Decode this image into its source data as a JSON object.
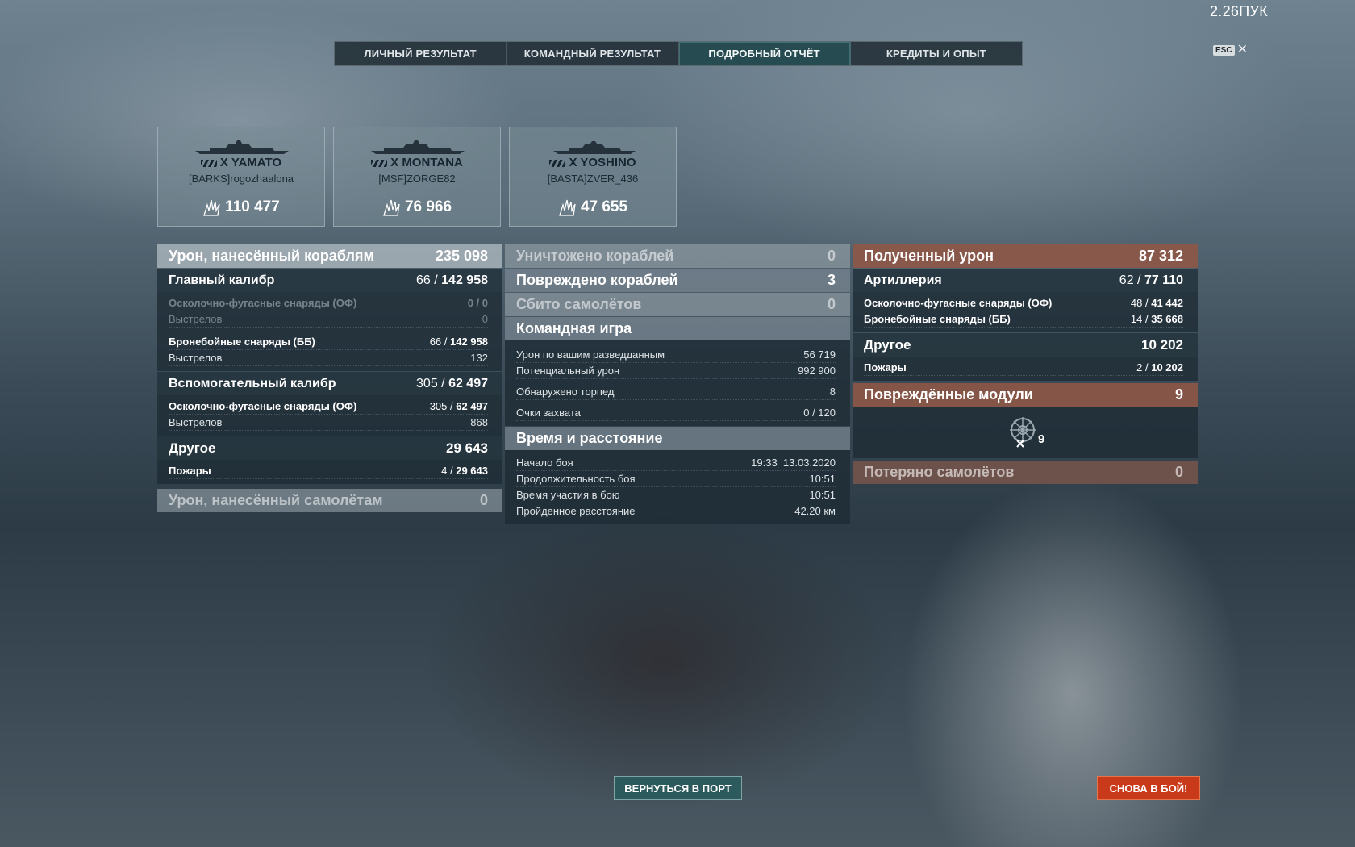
{
  "fps": "2.26ПУК",
  "esc_key": "ESC",
  "tabs": [
    {
      "label": "ЛИЧНЫЙ РЕЗУЛЬТАТ"
    },
    {
      "label": "КОМАНДНЫЙ РЕЗУЛЬТАТ"
    },
    {
      "label": "ПОДРОБНЫЙ ОТЧЁТ"
    },
    {
      "label": "КРЕДИТЫ И ОПЫТ"
    }
  ],
  "ships": [
    {
      "name": "X YAMATO",
      "player": "[BARKS]rogozhaalona",
      "damage": "110 477"
    },
    {
      "name": "X MONTANA",
      "player": "[MSF]ZORGE82",
      "damage": "76 966"
    },
    {
      "name": "X YOSHINO",
      "player": "[BASTA]ZVER_436",
      "damage": "47 655"
    }
  ],
  "left": {
    "ship_damage": {
      "label": "Урон, нанесённый кораблям",
      "value": "235 098"
    },
    "main_caliber": {
      "label": "Главный калибр",
      "hits": "66",
      "value": "142 958"
    },
    "he": {
      "label": "Осколочно-фугасные снаряды (ОФ)",
      "hits": "0",
      "value": "0"
    },
    "he_shots": {
      "label": "Выстрелов",
      "value": "0"
    },
    "ap": {
      "label": "Бронебойные снаряды (ББ)",
      "hits": "66",
      "value": "142 958"
    },
    "ap_shots": {
      "label": "Выстрелов",
      "value": "132"
    },
    "secondary": {
      "label": "Вспомогательный калибр",
      "hits": "305",
      "value": "62 497"
    },
    "sec_he": {
      "label": "Осколочно-фугасные снаряды (ОФ)",
      "hits": "305",
      "value": "62 497"
    },
    "sec_shots": {
      "label": "Выстрелов",
      "value": "868"
    },
    "other": {
      "label": "Другое",
      "value": "29 643"
    },
    "fires": {
      "label": "Пожары",
      "hits": "4",
      "value": "29 643"
    },
    "plane_damage": {
      "label": "Урон, нанесённый самолётам",
      "value": "0"
    }
  },
  "middle": {
    "destroyed": {
      "label": "Уничтожено кораблей",
      "value": "0"
    },
    "damaged": {
      "label": "Повреждено кораблей",
      "value": "3"
    },
    "planes_shot": {
      "label": "Сбито самолётов",
      "value": "0"
    },
    "team": {
      "label": "Командная игра"
    },
    "spotting": {
      "label": "Урон по вашим разведданным",
      "value": "56 719"
    },
    "potential": {
      "label": "Потенциальный урон",
      "value": "992 900"
    },
    "torps": {
      "label": "Обнаружено торпед",
      "value": "8"
    },
    "capture": {
      "label": "Очки захвата",
      "value": "0 / 120"
    },
    "time": {
      "label": "Время и расстояние"
    },
    "start": {
      "label": "Начало боя",
      "value": "19:33  13.03.2020"
    },
    "duration": {
      "label": "Продолжительность боя",
      "value": "10:51"
    },
    "participation": {
      "label": "Время участия в бою",
      "value": "10:51"
    },
    "distance": {
      "label": "Пройденное расстояние",
      "value": "42.20 км"
    }
  },
  "right": {
    "received": {
      "label": "Полученный урон",
      "value": "87 312"
    },
    "artillery": {
      "label": "Артиллерия",
      "hits": "62",
      "value": "77 110"
    },
    "he": {
      "label": "Осколочно-фугасные снаряды (ОФ)",
      "hits": "48",
      "value": "41 442"
    },
    "ap": {
      "label": "Бронебойные снаряды (ББ)",
      "hits": "14",
      "value": "35 668"
    },
    "other": {
      "label": "Другое",
      "value": "10 202"
    },
    "fires": {
      "label": "Пожары",
      "hits": "2",
      "value": "10 202"
    },
    "modules": {
      "label": "Повреждённые модули",
      "value": "9"
    },
    "module_count": "9",
    "planes_lost": {
      "label": "Потеряно самолётов",
      "value": "0"
    }
  },
  "buttons": {
    "port": "ВЕРНУТЬСЯ В ПОРТ",
    "battle": "СНОВА В БОЙ!"
  }
}
